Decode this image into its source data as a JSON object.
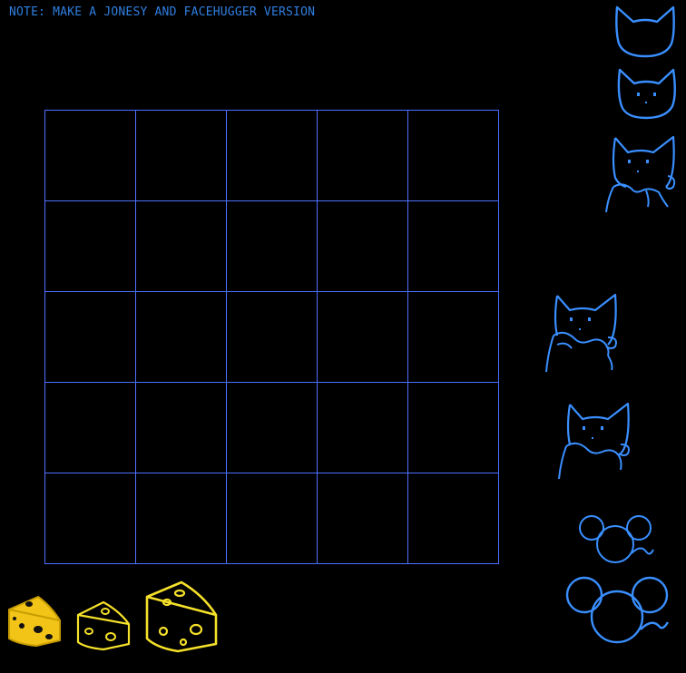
{
  "note": "NOTE: MAKE A JONESY AND FACEHUGGER VERSION",
  "board": {
    "rows": 5,
    "cols": 5,
    "line_color": "#4f70ff"
  },
  "sprites": {
    "cats": [
      {
        "id": "cat-head-blank",
        "icon": "cat-head-icon"
      },
      {
        "id": "cat-head-face",
        "icon": "cat-face-icon"
      },
      {
        "id": "cat-body",
        "icon": "cat-body-icon"
      },
      {
        "id": "cat-eating-mouse",
        "icon": "cat-eating-icon"
      },
      {
        "id": "cat-eating-mouse-2",
        "icon": "cat-eating-icon"
      }
    ],
    "mice": [
      {
        "id": "mouse-small",
        "icon": "mouse-icon"
      },
      {
        "id": "mouse-large",
        "icon": "mouse-icon"
      }
    ],
    "cheeses": [
      {
        "id": "cheese-filled",
        "icon": "cheese-icon"
      },
      {
        "id": "cheese-outline-small",
        "icon": "cheese-outline-icon"
      },
      {
        "id": "cheese-outline-large",
        "icon": "cheese-outline-icon"
      }
    ]
  },
  "colors": {
    "background": "#000000",
    "note_text": "#2f7fe0",
    "sprite_blue": "#3a8fff",
    "cheese_yellow": "#f5e02a",
    "cheese_fill": "#f2c418"
  }
}
